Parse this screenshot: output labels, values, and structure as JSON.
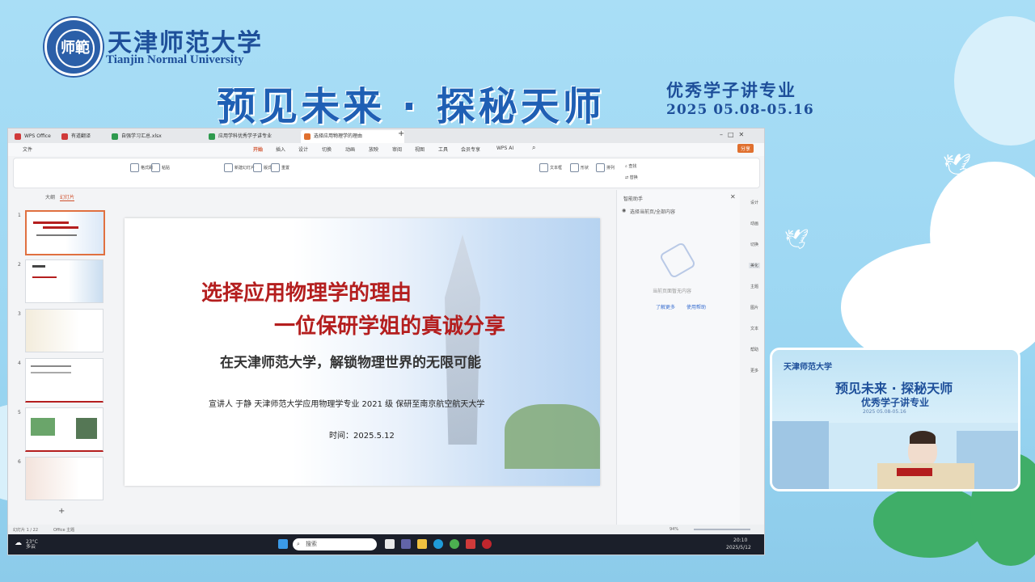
{
  "header": {
    "logo_text": "师範",
    "university_cn": "天津师范大学",
    "university_en": "Tianjin Normal University",
    "main_title": "预见未来 · 探秘天师",
    "sub_title": "优秀学子讲专业",
    "date_range": "2025 05.08-05.16"
  },
  "browser_tabs": [
    {
      "label": "WPS Office",
      "color": "#d03a3a"
    },
    {
      "label": "有道翻译",
      "color": "#d03a3a"
    },
    {
      "label": "自强学习汇总.xlsx",
      "color": "#2e9a4e"
    },
    {
      "label": "应用学科优秀学子讲专业",
      "color": "#2e9a4e"
    },
    {
      "label": "选择应用物理学的理由",
      "color": "#e0702f"
    }
  ],
  "menu": {
    "file": "文件",
    "items": [
      "开始",
      "插入",
      "设计",
      "切换",
      "动画",
      "放映",
      "审阅",
      "视图",
      "工具",
      "会员专享",
      "WPS AI"
    ],
    "share": "分享"
  },
  "ribbon": {
    "format_painter": "格式刷",
    "paste": "粘贴",
    "new_slide": "新建幻灯片",
    "layout": "版式",
    "reset": "重置",
    "textbox": "文本框",
    "shape": "形状",
    "arrange": "排列",
    "find": "查找",
    "replace": "替换"
  },
  "thumbnail_panel": {
    "tab_outline": "大纲",
    "tab_slides": "幻灯片",
    "numbers": [
      "1",
      "2",
      "3",
      "4",
      "5",
      "6"
    ],
    "add": "+"
  },
  "slide": {
    "title_line1": "选择应用物理学的理由",
    "title_line2": "一位保研学姐的真诚分享",
    "subtitle": "在天津师范大学，解锁物理世界的无限可能",
    "speaker": "宣讲人  于静  天津师范大学应用物理学专业 2021 级  保研至南京航空航天大学",
    "date": "时间：2025.5.12"
  },
  "side_panel": {
    "title": "智能助手",
    "hint": "选择当前页/全部内容",
    "empty_text": "当前页面暂无内容",
    "link1": "了解更多",
    "link2": "使用帮助"
  },
  "right_bar": [
    "设计",
    "动画",
    "切换",
    "美化",
    "主题",
    "图片",
    "文本",
    "帮助",
    "更多"
  ],
  "status": {
    "slide_count": "幻灯片 1 / 22",
    "theme": "Office 主题",
    "zoom": "94%"
  },
  "taskbar": {
    "weather": "23°C 多云",
    "search_placeholder": "搜索",
    "time": "20:10",
    "date": "2025/5/12"
  },
  "camera": {
    "logo": "天津师范大学",
    "title": "预见未来 · 探秘天师",
    "subtitle": "优秀学子讲专业",
    "small": "2025 05.08-05.16"
  }
}
